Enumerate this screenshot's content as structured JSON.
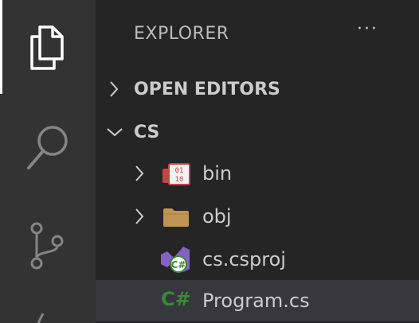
{
  "explorer": {
    "title": "EXPLORER",
    "more_actions": "···"
  },
  "sections": {
    "open_editors": "OPEN EDITORS",
    "workspace": "CS"
  },
  "tree": [
    {
      "label": "bin",
      "icon": "binary-folder-icon",
      "collapsed": true
    },
    {
      "label": "obj",
      "icon": "folder-icon",
      "collapsed": true
    },
    {
      "label": "cs.csproj",
      "icon": "csproj-icon"
    },
    {
      "label": "Program.cs",
      "icon": "csharp-icon",
      "selected": true
    }
  ],
  "icon_texts": {
    "binary_top": "01",
    "binary_bottom": "10",
    "csharp": "C#",
    "csproj_badge": "C#"
  },
  "colors": {
    "activity_bar": "#333333",
    "sidebar": "#252526",
    "selected_row": "#37373d",
    "csharp_green": "#388a34"
  }
}
